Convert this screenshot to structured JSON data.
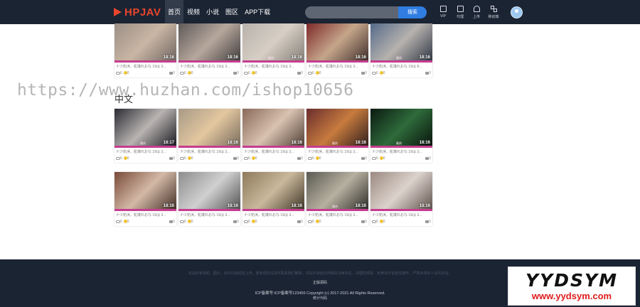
{
  "header": {
    "logo_text": "HPJAV",
    "nav": [
      "首页",
      "视频",
      "小说",
      "图区",
      "APP下载"
    ],
    "search_placeholder": "",
    "search_button": "搜索",
    "tools": [
      {
        "label": "VIP",
        "icon": "vip-icon"
      },
      {
        "label": "代理",
        "icon": "agent-icon"
      },
      {
        "label": "上传",
        "icon": "upload-cloud-icon"
      },
      {
        "label": "移动端",
        "icon": "qr-grid-icon"
      }
    ]
  },
  "watermark": "https://www.huzhan.com/ishop10656",
  "section_title": "中文",
  "rows": [
    [
      {
        "title": "ナ少奶浜、処壊れおな 19は 3...",
        "duration": "18:16",
        "views": "0",
        "coins": "0",
        "likes": "0",
        "badge": "",
        "colors": [
          "#9b8f86",
          "#c9b6a4",
          "#6e6460"
        ]
      },
      {
        "title": "ナ少奶浜、処壊れおな 19は 3...",
        "duration": "18:16",
        "views": "0",
        "coins": "0",
        "likes": "0",
        "badge": "",
        "colors": [
          "#5f5a58",
          "#b7a79d",
          "#3e3c3c"
        ]
      },
      {
        "title": "ナ少奶浜、処壊れおな 19は 3...",
        "duration": "18:16",
        "views": "0",
        "coins": "0",
        "likes": "0",
        "badge": "最热",
        "colors": [
          "#b8b1ab",
          "#d7cfc5",
          "#847d76"
        ]
      },
      {
        "title": "ナ少奶浜、処壊れおな 19は 3...",
        "duration": "18:16",
        "views": "0",
        "coins": "0",
        "likes": "0",
        "badge": "",
        "colors": [
          "#7e2a2a",
          "#c5a68a",
          "#3b2a28"
        ]
      },
      {
        "title": "ナ少奶浜、処壊れおな 19は 8...",
        "duration": "18:16",
        "views": "0",
        "coins": "0",
        "likes": "0",
        "badge": "最热",
        "colors": [
          "#566a8a",
          "#b6b2ae",
          "#2d3442"
        ]
      }
    ],
    [
      {
        "title": "ナ少奶浜、処壊れおな 19は 3...",
        "duration": "18:17",
        "views": "0",
        "coins": "0",
        "likes": "0",
        "badge": "最热",
        "colors": [
          "#2b2b33",
          "#b9b4b2",
          "#16161c"
        ]
      },
      {
        "title": "ナ少奶浜、処壊れおな 19は 3...",
        "duration": "18:16",
        "views": "0",
        "coins": "0",
        "likes": "0",
        "badge": "",
        "colors": [
          "#a89a86",
          "#e3c7a0",
          "#76695a"
        ]
      },
      {
        "title": "ナ少奶浜、処壊れおな 19は 3...",
        "duration": "18:16",
        "views": "0",
        "coins": "0",
        "likes": "0",
        "badge": "",
        "colors": [
          "#8a6a5a",
          "#d9c2b0",
          "#4d3b33"
        ]
      },
      {
        "title": "ナ少奶浜、処壊れおな 19は 3...",
        "duration": "18:16",
        "views": "0",
        "coins": "0",
        "likes": "0",
        "badge": "最热",
        "colors": [
          "#6a2d2d",
          "#c77b3e",
          "#2c1b1b"
        ]
      },
      {
        "title": "ナ少奶浜、処壊れおな 19は 3...",
        "duration": "18:16",
        "views": "0",
        "coins": "0",
        "likes": "0",
        "badge": "最热",
        "colors": [
          "#0c1a12",
          "#2e6b3a",
          "#08120c"
        ]
      }
    ],
    [
      {
        "title": "ナ少奶浜、処壊れおな 19は 3...",
        "duration": "18:16",
        "views": "0",
        "coins": "0",
        "likes": "0",
        "badge": "",
        "colors": [
          "#7a4a3a",
          "#d3b9a6",
          "#3f2b24"
        ]
      },
      {
        "title": "ナ少奶浜、処壊れおな 19は 3...",
        "duration": "18:16",
        "views": "0",
        "coins": "0",
        "likes": "0",
        "badge": "",
        "colors": [
          "#8d8d8d",
          "#d0d0d0",
          "#4f4f4f"
        ]
      },
      {
        "title": "ナ少奶浜、処壊れおな 19は 3...",
        "duration": "18:16",
        "views": "0",
        "coins": "0",
        "likes": "0",
        "badge": "",
        "colors": [
          "#8e7a5c",
          "#c9b89b",
          "#3c3426"
        ]
      },
      {
        "title": "ナ少奶浜、処壊れおな 19は 3...",
        "duration": "18:16",
        "views": "0",
        "coins": "0",
        "likes": "0",
        "badge": "最热",
        "colors": [
          "#5a5a52",
          "#b7b0a0",
          "#2a2a26"
        ]
      },
      {
        "title": "ナ少奶浜、処壊れおな 19は 3...",
        "duration": "18:16",
        "views": "0",
        "coins": "0",
        "likes": "0",
        "badge": "",
        "colors": [
          "#9a8a82",
          "#dcd2cc",
          "#5c4f4a"
        ]
      }
    ]
  ],
  "footer": {
    "disclaimer": "本站所有视频、图片、资讯均由网友上传，若有侵权请及时联系我们删除。本站不承担任何相关法律责任，请理性观看，未满18岁请自觉离开，严禁未成年人访问本站。",
    "link": "正版源码",
    "copyright": "ICP备案号:ICP备案号123456    Copyright (c) 2017-2021 All Rights Reserved.",
    "stats": "统计代码"
  },
  "stamp": {
    "big": "YYDSYM",
    "small": "www.yydsym.com"
  }
}
